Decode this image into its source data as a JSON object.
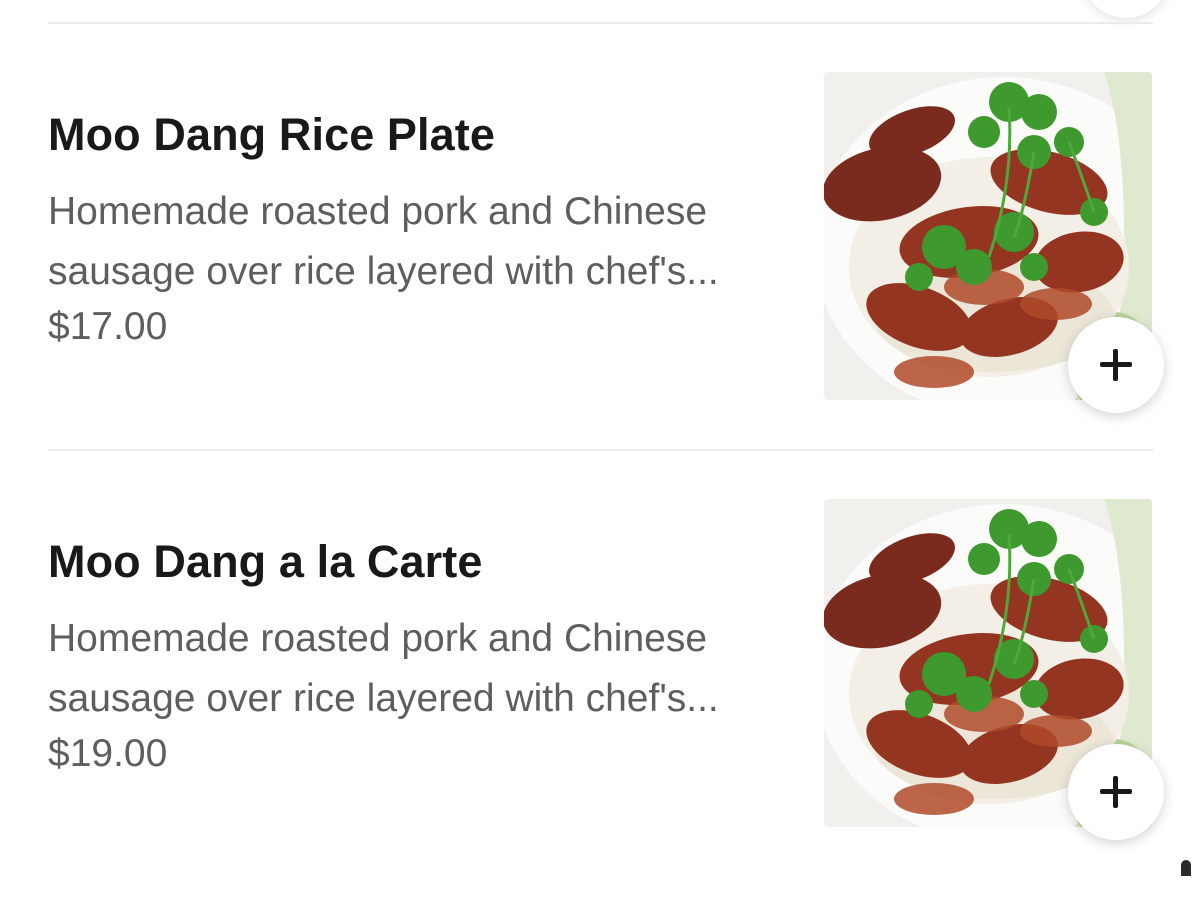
{
  "menu": {
    "items": [
      {
        "name": "Moo Dang Rice Plate",
        "description": "Homemade roasted pork and Chinese sausage over rice layered with chef's...",
        "price": "$17.00"
      },
      {
        "name": "Moo Dang a la Carte",
        "description": "Homemade roasted pork and Chinese sausage over rice layered with chef's...",
        "price": "$19.00"
      }
    ]
  },
  "icons": {
    "add": "plus-icon"
  },
  "colors": {
    "title_text": "#191919",
    "secondary_text": "#5e5e5e",
    "divider": "#ececec",
    "background": "#ffffff"
  }
}
